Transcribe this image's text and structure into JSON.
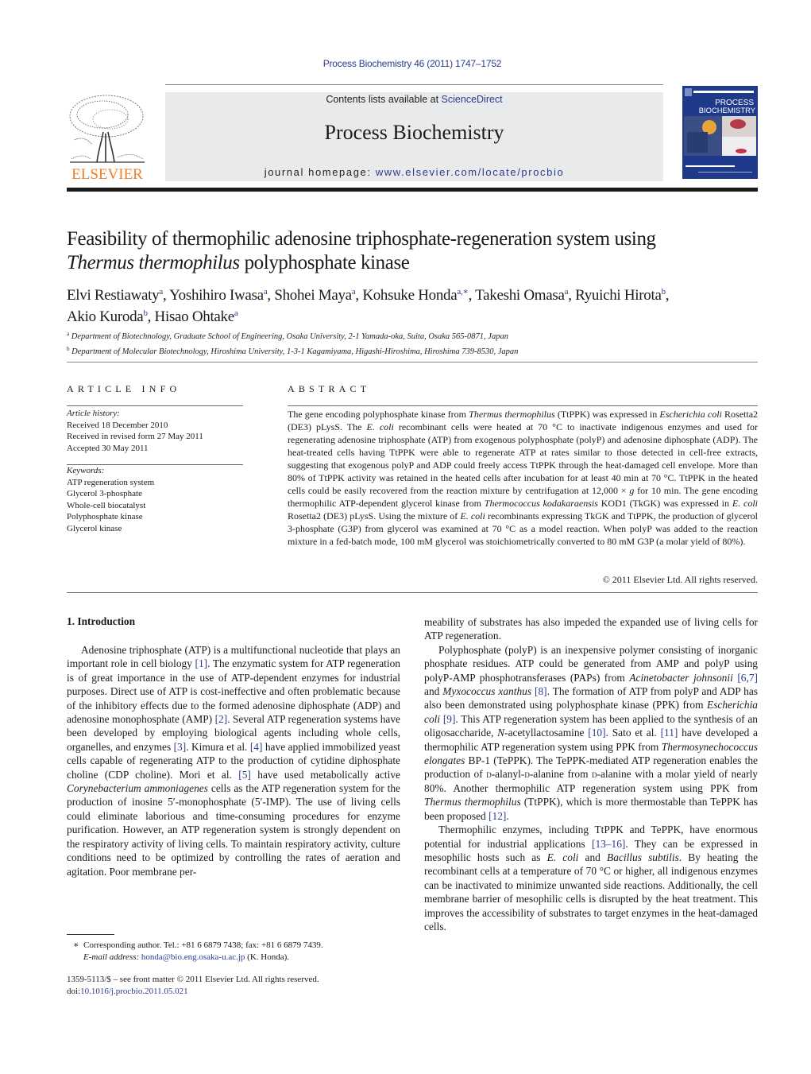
{
  "header": {
    "citation": "Process Biochemistry 46 (2011) 1747–1752",
    "contents_prefix": "Contents lists available at ",
    "contents_link": "ScienceDirect",
    "journal_name": "Process Biochemistry",
    "homepage_prefix": "journal homepage: ",
    "homepage_link": "www.elsevier.com/locate/procbio",
    "publisher_logo_text": "ELSEVIER",
    "cover_title_line1": "PROCESS",
    "cover_title_line2": "BIOCHEMISTRY",
    "colors": {
      "link": "#2b3c8f",
      "elsevier_orange": "#f07e26",
      "cover_blue": "#1f3a8a"
    }
  },
  "article": {
    "title_line1": "Feasibility of thermophilic adenosine triphosphate-regeneration system using",
    "title_italic": "Thermus thermophilus",
    "title_rest": " polyphosphate kinase",
    "authors": [
      {
        "name": "Elvi Restiawaty",
        "sup": "a"
      },
      {
        "name": "Yoshihiro Iwasa",
        "sup": "a"
      },
      {
        "name": "Shohei Maya",
        "sup": "a"
      },
      {
        "name": "Kohsuke Honda",
        "sup": "a,∗"
      },
      {
        "name": "Takeshi Omasa",
        "sup": "a"
      },
      {
        "name": "Ryuichi Hirota",
        "sup": "b"
      },
      {
        "name": "Akio Kuroda",
        "sup": "b"
      },
      {
        "name": "Hisao Ohtake",
        "sup": "a"
      }
    ],
    "affiliations": [
      {
        "mark": "a",
        "text": "Department of Biotechnology, Graduate School of Engineering, Osaka University, 2-1 Yamada-oka, Suita, Osaka 565-0871, Japan"
      },
      {
        "mark": "b",
        "text": "Department of Molecular Biotechnology, Hiroshima University, 1-3-1 Kagamiyama, Higashi-Hiroshima, Hiroshima 739-8530, Japan"
      }
    ]
  },
  "article_info": {
    "heading": "ARTICLE INFO",
    "history_label": "Article history:",
    "history": [
      "Received 18 December 2010",
      "Received in revised form 27 May 2011",
      "Accepted 30 May 2011"
    ],
    "keywords_label": "Keywords:",
    "keywords": [
      "ATP regeneration system",
      "Glycerol 3-phosphate",
      "Whole-cell biocatalyst",
      "Polyphosphate kinase",
      "Glycerol kinase"
    ]
  },
  "abstract": {
    "heading": "ABSTRACT",
    "p1a": "The gene encoding polyphosphate kinase from ",
    "p1b": "Thermus thermophilus",
    "p1c": " (TtPPK) was expressed in ",
    "p1d": "Escherichia coli",
    "p1e": " Rosetta2 (DE3) pLysS. The ",
    "p1f": "E. coli",
    "p1g": " recombinant cells were heated at 70 °C to inactivate indigenous enzymes and used for regenerating adenosine triphosphate (ATP) from exogenous polyphosphate (polyP) and adenosine diphosphate (ADP). The heat-treated cells having TtPPK were able to regenerate ATP at rates similar to those detected in cell-free extracts, suggesting that exogenous polyP and ADP could freely access TtPPK through the heat-damaged cell envelope. More than 80% of TtPPK activity was retained in the heated cells after incubation for at least 40 min at 70 °C. TtPPK in the heated cells could be easily recovered from the reaction mixture by centrifugation at 12,000 × ",
    "p1h": "g",
    "p1i": " for 10 min. The gene encoding thermophilic ATP-dependent glycerol kinase from ",
    "p1j": "Thermococcus kodakaraensis",
    "p1k": " KOD1 (TkGK) was expressed in ",
    "p1l": "E. coli",
    "p1m": " Rosetta2 (DE3) pLysS. Using the mixture of ",
    "p1n": "E. coli",
    "p1o": " recombinants expressing TkGK and TtPPK, the production of glycerol 3-phosphate (G3P) from glycerol was examined at 70 °C as a model reaction. When polyP was added to the reaction mixture in a fed-batch mode, 100 mM glycerol was stoichiometrically converted to 80 mM G3P (a molar yield of 80%).",
    "copyright": "© 2011 Elsevier Ltd. All rights reserved."
  },
  "body": {
    "section_heading": "1.  Introduction",
    "left": {
      "s1": "Adenosine triphosphate (ATP) is a multifunctional nucleotide that plays an important role in cell biology ",
      "r1": "[1]",
      "s2": ". The enzymatic system for ATP regeneration is of great importance in the use of ATP-dependent enzymes for industrial purposes. Direct use of ATP is cost-ineffective and often problematic because of the inhibitory effects due to the formed adenosine diphosphate (ADP) and adenosine monophosphate (AMP) ",
      "r2": "[2]",
      "s3": ". Several ATP regeneration systems have been developed by employing biological agents including whole cells, organelles, and enzymes ",
      "r3": "[3]",
      "s4": ". Kimura et al. ",
      "r4": "[4]",
      "s5": " have applied immobilized yeast cells capable of regenerating ATP to the production of cytidine diphosphate choline (CDP choline). Mori et al. ",
      "r5": "[5]",
      "s6": " have used metabolically active ",
      "i1": "Corynebacterium ammoniagenes",
      "s7": " cells as the ATP regeneration system for the production of inosine 5′-monophosphate (5′-IMP). The use of living cells could eliminate laborious and time-consuming procedures for enzyme purification. However, an ATP regeneration system is strongly dependent on the respiratory activity of living cells. To maintain respiratory activity, culture conditions need to be optimized by controlling the rates of aeration and agitation. Poor membrane per-"
    },
    "right": {
      "p0": "meability of substrates has also impeded the expanded use of living cells for ATP regeneration.",
      "a1": "Polyphosphate (polyP) is an inexpensive polymer consisting of inorganic phosphate residues. ATP could be generated from AMP and polyP using polyP-AMP phosphotransferases (PAPs) from ",
      "ai1": "Acinetobacter johnsonii",
      "ar1": "[6,7]",
      "a2": " and ",
      "ai2": "Myxococcus xanthus",
      "ar2": "[8]",
      "a3": ". The formation of ATP from polyP and ADP has also been demonstrated using polyphosphate kinase (PPK) from ",
      "ai3": "Escherichia coli",
      "ar3": "[9]",
      "a4": ". This ATP regeneration system has been applied to the synthesis of an oligosaccharide, ",
      "ai4": "N",
      "a5": "-acetyllactosamine ",
      "ar4": "[10]",
      "a6": ". Sato et al. ",
      "ar5": "[11]",
      "a7": " have developed a thermophilic ATP regeneration system using PPK from ",
      "ai5": "Thermosynechococcus elongates",
      "a8": " BP-1 (TePPK). The TePPK-mediated ATP regeneration enables the production of ",
      "asc1": "d",
      "a9": "-alanyl-",
      "asc2": "d",
      "a10": "-alanine from ",
      "asc3": "d",
      "a11": "-alanine with a molar yield of nearly 80%. Another thermophilic ATP regeneration system using PPK from ",
      "ai6": "Thermus thermophilus",
      "a12": " (TtPPK), which is more thermostable than TePPK has been proposed ",
      "ar6": "[12]",
      "a13": ".",
      "b1": "Thermophilic enzymes, including TtPPK and TePPK, have enormous potential for industrial applications ",
      "br1": "[13–16]",
      "b2": ". They can be expressed in mesophilic hosts such as ",
      "bi1": "E. coli",
      "b3": " and ",
      "bi2": "Bacillus subtilis",
      "b4": ". By heating the recombinant cells at a temperature of 70 °C or higher, all indigenous enzymes can be inactivated to minimize unwanted side reactions. Additionally, the cell membrane barrier of mesophilic cells is disrupted by the heat treatment. This improves the accessibility of substrates to target enzymes in the heat-damaged cells."
    }
  },
  "footnote": {
    "star": "∗",
    "corresponding": "Corresponding author. Tel.: +81 6 6879 7438; fax: +81 6 6879 7439.",
    "email_label": "E-mail address: ",
    "email": "honda@bio.eng.osaka-u.ac.jp",
    "email_suffix": " (K. Honda)."
  },
  "frontmatter": {
    "issn_line": "1359-5113/$ – see front matter © 2011 Elsevier Ltd. All rights reserved.",
    "doi_prefix": "doi:",
    "doi": "10.1016/j.procbio.2011.05.021"
  }
}
